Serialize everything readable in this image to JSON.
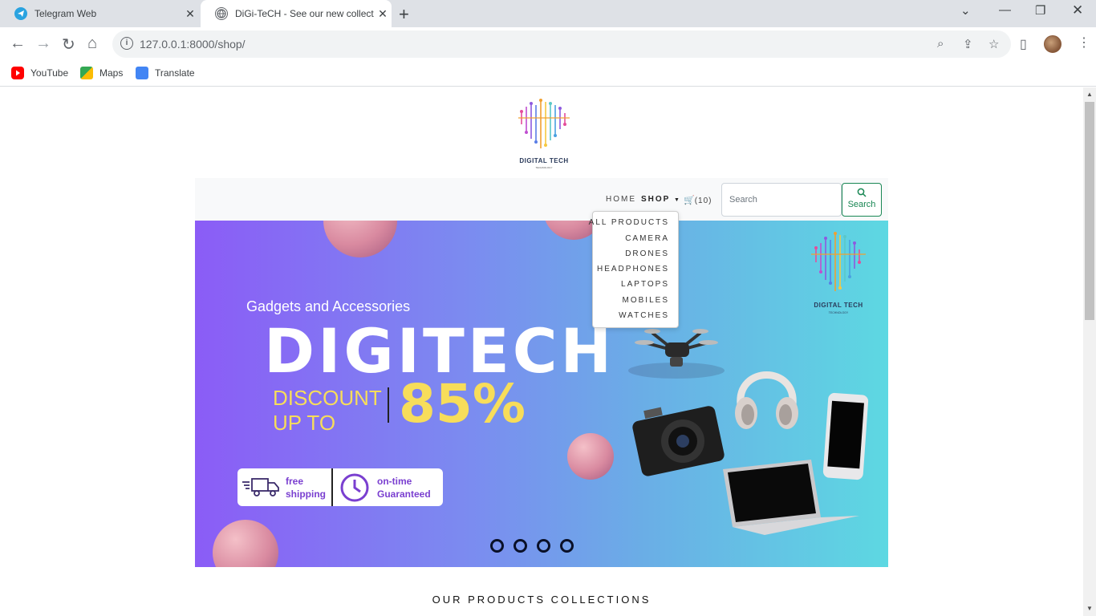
{
  "browser": {
    "tabs": [
      {
        "title": "Telegram Web",
        "icon": "telegram-icon"
      },
      {
        "title": "DiGi-TeCH - See our new collecti",
        "icon": "globe-icon",
        "active": true
      }
    ],
    "url_host": "127.0.0.1",
    "url_rest": ":8000/shop/",
    "bookmarks": [
      {
        "label": "YouTube",
        "icon": "youtube-icon",
        "color": "#ff0000"
      },
      {
        "label": "Maps",
        "icon": "maps-icon",
        "color": "#34a853"
      },
      {
        "label": "Translate",
        "icon": "translate-icon",
        "color": "#4285f4"
      }
    ]
  },
  "site": {
    "logo_text": "DIGITAL TECH",
    "logo_tagline": "TECHNOLOGY",
    "nav": {
      "home": "HOME",
      "shop": "SHOP",
      "cart_count": "(10)"
    },
    "search": {
      "placeholder": "Search",
      "button_label": "Search"
    },
    "shop_menu": [
      "ALL PRODUCTS",
      "CAMERA",
      "DRONES",
      "HEADPHONES",
      "LAPTOPS",
      "MOBILES",
      "WATCHES"
    ],
    "hero": {
      "subtitle": "Gadgets and Accessories",
      "title": "DIGITECH",
      "discount_line1": "DISCOUNT",
      "discount_line2": "UP TO",
      "discount_value": "85%",
      "badge_shipping_1": "free",
      "badge_shipping_2": "shipping",
      "badge_time_1": "on-time",
      "badge_time_2": "Guaranteed",
      "slide_count": 4
    },
    "section_title": "OUR PRODUCTS COLLECTIONS"
  },
  "colors": {
    "accent_green": "#198754",
    "hero_yellow": "#f7dd5a",
    "badge_purple": "#7a3fd0"
  }
}
